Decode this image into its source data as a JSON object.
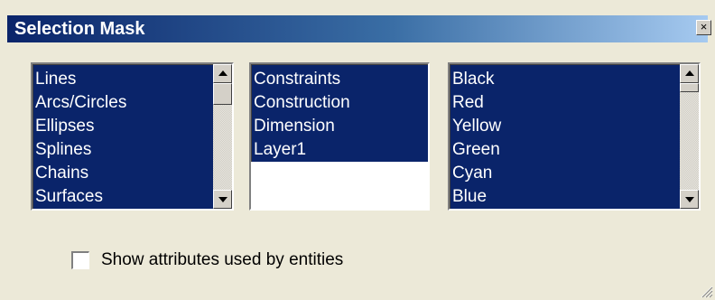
{
  "window": {
    "title": "Selection Mask",
    "close_glyph": "×"
  },
  "entities_list": {
    "items": [
      "Lines",
      "Arcs/Circles",
      "Ellipses",
      "Splines",
      "Chains",
      "Surfaces"
    ]
  },
  "layers_list": {
    "items": [
      "Constraints",
      "Construction",
      "Dimension",
      "Layer1"
    ]
  },
  "colors_list": {
    "items": [
      "Black",
      "Red",
      "Yellow",
      "Green",
      "Cyan",
      "Blue"
    ]
  },
  "options": {
    "show_attributes_label": "Show attributes used by entities",
    "show_attributes_checked": false
  },
  "icons": {
    "scroll_up": "scroll-up-arrow-icon",
    "scroll_down": "scroll-down-arrow-icon",
    "close": "close-icon",
    "resize_grip": "resize-grip-icon"
  },
  "colors": {
    "selection_background": "#0a246a",
    "dialog_background": "#ece9d8",
    "title_gradient_start": "#0a246a",
    "title_gradient_end": "#a6caf0"
  }
}
